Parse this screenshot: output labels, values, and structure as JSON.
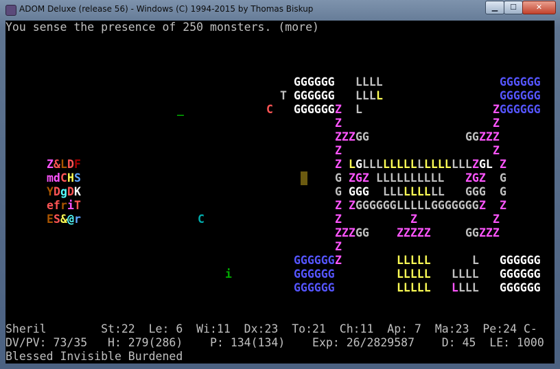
{
  "window": {
    "title": "ADOM Deluxe (release 56) - Windows (C) 1994-2015 by Thomas Biskup",
    "min_label": "▁",
    "max_label": "☐",
    "close_label": "✕"
  },
  "message": "You sense the presence of 250 monsters. (more)",
  "status": {
    "line1": "Sheril        St:22  Le: 6  Wi:11  Dx:23  To:21  Ch:11  Ap: 7  Ma:23  Pe:24 C-",
    "line2": "DV/PV: 73/35   H: 279(286)    P: 134(134)    Exp: 26/2829587    D: 45  LE: 1000",
    "line3": "Blessed Invisible Burdened"
  },
  "palette": {
    "w": "#ffffff",
    "g": "#c0c0c0",
    "y": "#ffff55",
    "m": "#ff55ff",
    "b": "#5555ff",
    "r": "#ff5555",
    "R": "#aa0000",
    "c": "#55ffff",
    "C": "#00aaaa",
    "G": "#00aa00",
    "o": "#aa5500",
    "B": "#5fa8ff",
    "d": "#808080"
  },
  "map_rows": [
    [
      [
        42,
        "GGGGGG",
        "w"
      ],
      [
        51,
        "LLLL",
        "g"
      ],
      [
        72,
        "GGGGGG",
        "b"
      ]
    ],
    [
      [
        40,
        "T",
        "g"
      ],
      [
        42,
        "GGGGGG",
        "w"
      ],
      [
        51,
        "LLL",
        "g"
      ],
      [
        54,
        "L",
        "y"
      ],
      [
        72,
        "GGGGGG",
        "b"
      ]
    ],
    [
      [
        25,
        "_",
        "G"
      ],
      [
        38,
        "C",
        "r"
      ],
      [
        42,
        "GGGGGG",
        "w"
      ],
      [
        48,
        "Z",
        "m"
      ],
      [
        51,
        "L",
        "g"
      ],
      [
        71,
        "Z",
        "m"
      ],
      [
        72,
        "GGGGGG",
        "b"
      ]
    ],
    [
      [
        48,
        "Z",
        "m"
      ],
      [
        71,
        "Z",
        "m"
      ]
    ],
    [
      [
        48,
        "ZZZ",
        "m"
      ],
      [
        51,
        "GG",
        "g"
      ],
      [
        67,
        "GG",
        "g"
      ],
      [
        69,
        "ZZZ",
        "m"
      ]
    ],
    [
      [
        48,
        "Z",
        "m"
      ],
      [
        71,
        "Z",
        "m"
      ]
    ],
    [
      [
        6,
        "Z",
        "m"
      ],
      [
        7,
        "&",
        "r"
      ],
      [
        8,
        "L",
        "o"
      ],
      [
        9,
        "D",
        "r"
      ],
      [
        10,
        "F",
        "R"
      ],
      [
        48,
        "Z",
        "m"
      ],
      [
        50,
        "L",
        "y"
      ],
      [
        51,
        "G",
        "w"
      ],
      [
        52,
        "LLL",
        "g"
      ],
      [
        55,
        "LLLLL",
        "y"
      ],
      [
        60,
        "L",
        "g"
      ],
      [
        61,
        "LLLL",
        "y"
      ],
      [
        65,
        "LLL",
        "g"
      ],
      [
        68,
        "Z",
        "m"
      ],
      [
        69,
        "GL",
        "w"
      ],
      [
        72,
        "Z",
        "m"
      ]
    ],
    [
      [
        6,
        "md",
        "m"
      ],
      [
        8,
        "C",
        "r"
      ],
      [
        9,
        "H",
        "y"
      ],
      [
        10,
        "S",
        "B"
      ],
      [
        48,
        "G",
        "g"
      ],
      [
        50,
        "ZGZ",
        "m"
      ],
      [
        54,
        "LLLLLLLLLL",
        "g"
      ],
      [
        67,
        "ZGZ",
        "m"
      ],
      [
        72,
        "G",
        "g"
      ]
    ],
    [
      [
        6,
        "Y",
        "o"
      ],
      [
        7,
        "D",
        "r"
      ],
      [
        8,
        "g",
        "c"
      ],
      [
        9,
        "D",
        "r"
      ],
      [
        10,
        "K",
        "w"
      ],
      [
        48,
        "G",
        "g"
      ],
      [
        50,
        "GGG",
        "w"
      ],
      [
        55,
        "LLL",
        "g"
      ],
      [
        58,
        "LLLL",
        "y"
      ],
      [
        62,
        "LL",
        "g"
      ],
      [
        67,
        "GGG",
        "g"
      ],
      [
        72,
        "G",
        "g"
      ]
    ],
    [
      [
        6,
        "ef",
        "r"
      ],
      [
        8,
        "r",
        "o"
      ],
      [
        9,
        "i",
        "m"
      ],
      [
        10,
        "T",
        "r"
      ],
      [
        48,
        "Z",
        "m"
      ],
      [
        50,
        "Z",
        "m"
      ],
      [
        51,
        "GGGGGG",
        "g"
      ],
      [
        57,
        "LLLLL",
        "g"
      ],
      [
        62,
        "GGGGGGG",
        "g"
      ],
      [
        69,
        "Z",
        "m"
      ],
      [
        72,
        "Z",
        "m"
      ]
    ],
    [
      [
        6,
        "E",
        "o"
      ],
      [
        7,
        "S",
        "r"
      ],
      [
        8,
        "&",
        "y"
      ],
      [
        9,
        "@",
        "c"
      ],
      [
        10,
        "r",
        "B"
      ],
      [
        28,
        "C",
        "C"
      ],
      [
        48,
        "Z",
        "m"
      ],
      [
        59,
        "Z",
        "m"
      ],
      [
        71,
        "Z",
        "m"
      ]
    ],
    [
      [
        48,
        "ZZZ",
        "m"
      ],
      [
        51,
        "GG",
        "g"
      ],
      [
        57,
        "ZZZZZ",
        "m"
      ],
      [
        67,
        "GG",
        "g"
      ],
      [
        69,
        "ZZZ",
        "m"
      ]
    ],
    [
      [
        48,
        "Z",
        "m"
      ]
    ],
    [
      [
        42,
        "GGGGGG",
        "b"
      ],
      [
        48,
        "Z",
        "m"
      ],
      [
        57,
        "LLLLL",
        "y"
      ],
      [
        68,
        "L",
        "g"
      ],
      [
        72,
        "GGGGGG",
        "w"
      ]
    ],
    [
      [
        32,
        "i",
        "G"
      ],
      [
        42,
        "GGGGGG",
        "b"
      ],
      [
        57,
        "LLLLL",
        "y"
      ],
      [
        65,
        "LLLL",
        "g"
      ],
      [
        72,
        "GGGGGG",
        "w"
      ]
    ],
    [
      [
        42,
        "GGGGGG",
        "b"
      ],
      [
        57,
        "LLLLL",
        "y"
      ],
      [
        65,
        "L",
        "m"
      ],
      [
        66,
        "LLL",
        "g"
      ],
      [
        72,
        "GGGGGG",
        "w"
      ]
    ]
  ]
}
